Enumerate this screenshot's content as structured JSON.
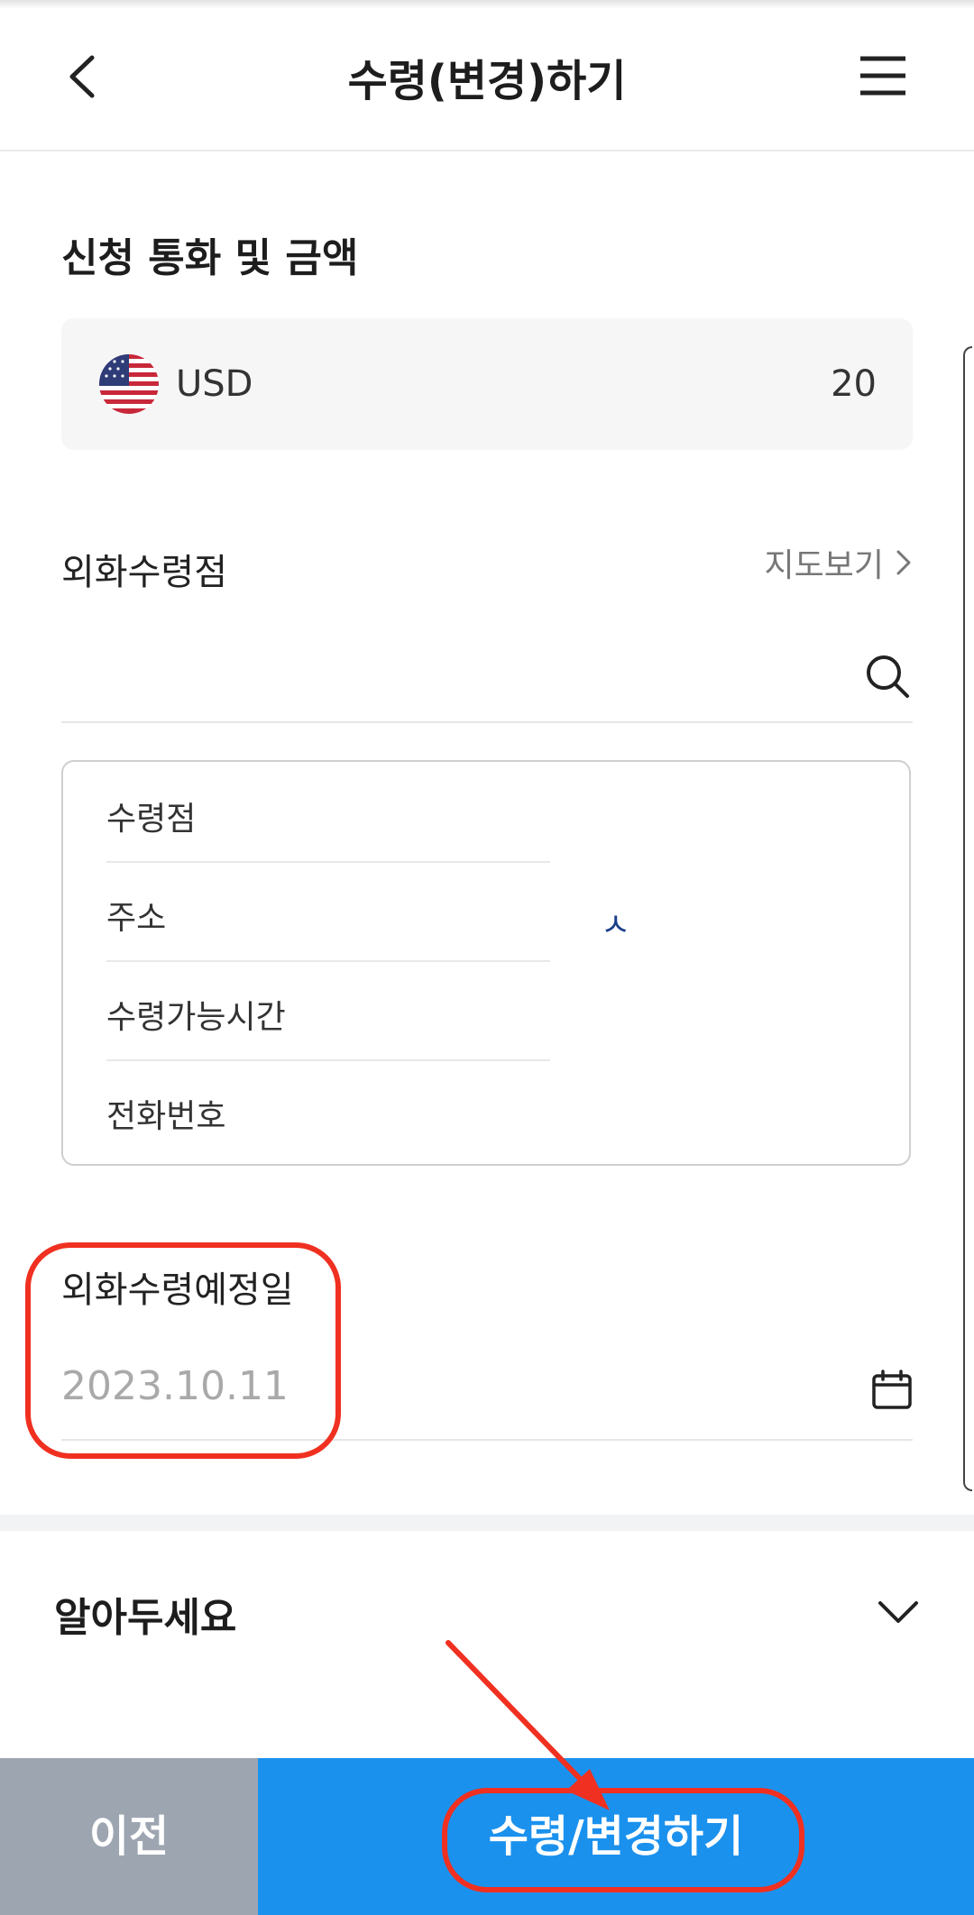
{
  "header": {
    "title": "수령(변경)하기"
  },
  "currency_section": {
    "title": "신청 통화 및 금액",
    "currency_code": "USD",
    "amount": "20",
    "flag_icon": "us-flag-icon"
  },
  "branch": {
    "label": "외화수령점",
    "map_link": "지도보기",
    "search_placeholder": "",
    "info_rows": [
      {
        "label": "수령점"
      },
      {
        "label": "주소"
      },
      {
        "label": "수령가능시간"
      },
      {
        "label": "전화번호"
      }
    ],
    "address_fragment": "ㅅ"
  },
  "date_section": {
    "label": "외화수령예정일",
    "value": "2023.10.11"
  },
  "notice": {
    "title": "알아두세요"
  },
  "footer": {
    "prev_label": "이전",
    "submit_label": "수령/변경하기"
  },
  "colors": {
    "primary": "#1b91ee",
    "secondary": "#9da5b1",
    "annotation": "#f03020"
  }
}
